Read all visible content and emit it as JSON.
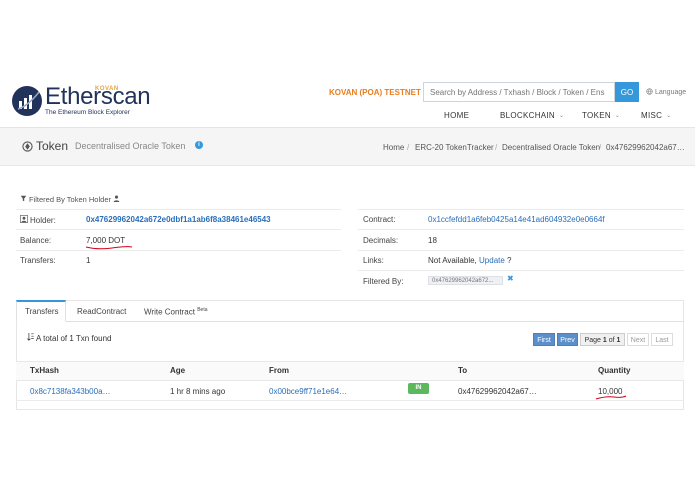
{
  "header": {
    "logo_text": "Etherscan",
    "logo_tagline": "The Ethereum Block Explorer",
    "logo_badge": "KOVAN",
    "network": "KOVAN (POA) TESTNET",
    "search_placeholder": "Search by Address / Txhash / Block / Token / Ens",
    "search_button": "GO",
    "language": "Language",
    "nav": [
      "HOME",
      "BLOCKCHAIN",
      "TOKEN",
      "MISC"
    ]
  },
  "title_bar": {
    "title": "Token",
    "subtitle": "Decentralised Oracle Token",
    "breadcrumb": [
      "Home",
      "ERC-20 TokenTracker",
      "Decentralised Oracle Token",
      "0x47629962042a67…"
    ]
  },
  "filter": {
    "heading": "Filtered By Token Holder",
    "left": [
      {
        "label": "Holder:",
        "value": "0x47629962042a672e0dbf1a1ab6f8a38461e46543"
      },
      {
        "label": "Balance:",
        "value": "7,000 DOT"
      },
      {
        "label": "Transfers:",
        "value": "1"
      }
    ],
    "right": {
      "contract_label": "Contract:",
      "contract_value": "0x1ccfefdd1a6feb0425a14e41ad604932e0e0664f",
      "decimals_label": "Decimals:",
      "decimals_value": "18",
      "links_label": "Links:",
      "links_prefix": "Not Available,",
      "links_update": "Update",
      "links_suffix": "?",
      "filtered_label": "Filtered By:",
      "filtered_value": "0x47629962042a672..."
    }
  },
  "tabs": [
    "Transfers",
    "ReadContract",
    "Write Contract"
  ],
  "beta_label": "Beta",
  "txn_count": "A total of 1 Txn found",
  "pagination": {
    "first": "First",
    "prev": "Prev",
    "page_prefix": "Page",
    "page_current": "1",
    "page_of": "of",
    "page_total": "1",
    "next": "Next",
    "last": "Last"
  },
  "table": {
    "headers": [
      "TxHash",
      "Age",
      "From",
      "To",
      "Quantity"
    ],
    "rows": [
      {
        "txhash": "0x8c7138fa343b00a…",
        "age": "1 hr 8 mins ago",
        "from": "0x00bce9ff71e1e64…",
        "direction": "IN",
        "to": "0x47629962042a67…",
        "quantity": "10,000"
      }
    ]
  },
  "colors": {
    "brand_navy": "#21325b",
    "accent_blue": "#3498db",
    "testnet_orange": "#e67e22",
    "in_green": "#5cb85c",
    "annotation_red": "#d0021b"
  },
  "icons": [
    "filter-icon",
    "user-icon",
    "token-icon",
    "info-icon",
    "globe-icon",
    "sort-icon",
    "close-icon"
  ]
}
